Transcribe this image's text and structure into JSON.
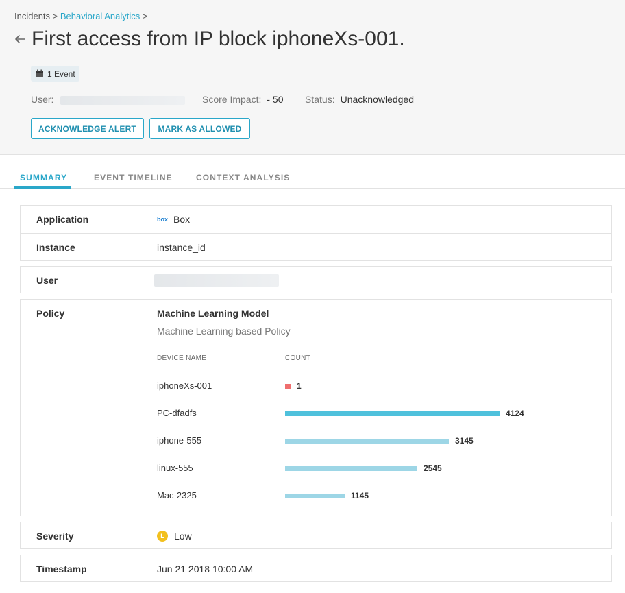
{
  "breadcrumb": {
    "items": [
      "Incidents",
      "Behavioral Analytics"
    ],
    "separator": ">"
  },
  "header": {
    "title": "First access from IP block iphoneXs-001.",
    "event_badge": "1 Event",
    "user_label": "User:",
    "score_label": "Score Impact:",
    "score_value": "- 50",
    "status_label": "Status:",
    "status_value": "Unacknowledged",
    "acknowledge_button": "ACKNOWLEDGE ALERT",
    "allow_button": "MARK AS ALLOWED"
  },
  "tabs": [
    {
      "label": "SUMMARY",
      "active": true
    },
    {
      "label": "EVENT TIMELINE",
      "active": false
    },
    {
      "label": "CONTEXT ANALYSIS",
      "active": false
    }
  ],
  "summary": {
    "application_label": "Application",
    "application_logo": "box",
    "application_value": "Box",
    "instance_label": "Instance",
    "instance_value": "instance_id",
    "user_label": "User",
    "policy_label": "Policy",
    "policy_name": "Machine Learning Model",
    "policy_desc": "Machine Learning based Policy",
    "severity_label": "Severity",
    "severity_badge": "L",
    "severity_value": "Low",
    "timestamp_label": "Timestamp",
    "timestamp_value": "Jun 21 2018 10:00 AM"
  },
  "chart_data": {
    "type": "bar",
    "orientation": "horizontal",
    "xlabel": "COUNT",
    "ylabel": "DEVICE NAME",
    "categories": [
      "iphoneXs-001",
      "PC-dfadfs",
      "iphone-555",
      "linux-555",
      "Mac-2325"
    ],
    "values": [
      1,
      4124,
      3145,
      2545,
      1145
    ],
    "colors": [
      "#ef6e6e",
      "#4fc1dc",
      "#9dd6e6",
      "#9dd6e6",
      "#9dd6e6"
    ]
  },
  "colors": {
    "accent": "#2aa7c9",
    "severity_low": "#f2c01e"
  }
}
